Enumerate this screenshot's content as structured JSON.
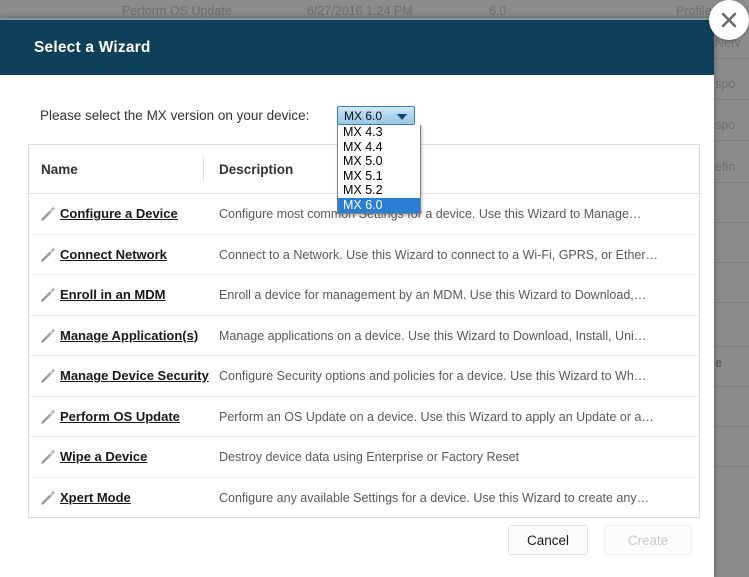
{
  "background": {
    "top_row": {
      "name": "Perform OS Update",
      "date": "6/27/2016 1:24 PM",
      "version": "6.0",
      "profile": "Profile"
    },
    "right_edge_fragments": [
      "Netv",
      "spo",
      "spo",
      "efin",
      "e"
    ]
  },
  "modal": {
    "title": "Select a Wizard",
    "close_label": "×",
    "prompt": "Please select the MX version on your device:",
    "help_icon_label": "?",
    "mx_select": {
      "value": "MX 6.0",
      "options": [
        "MX 4.3",
        "MX 4.4",
        "MX 5.0",
        "MX 5.1",
        "MX 5.2",
        "MX 6.0"
      ],
      "selected_index": 5,
      "expanded": true
    },
    "table": {
      "columns": [
        "Name",
        "Description"
      ],
      "rows": [
        {
          "icon": "wand-icon",
          "name": "Configure a Device",
          "description": "Configure most common Settings for a device. Use this Wizard to Manage…"
        },
        {
          "icon": "wand-icon",
          "name": "Connect Network",
          "description": "Connect to a Network. Use this Wizard to connect to a Wi-Fi, GPRS, or Ether…"
        },
        {
          "icon": "wand-icon",
          "name": "Enroll in an MDM",
          "description": "Enroll a device for management by an MDM.  Use this Wizard to Download,…"
        },
        {
          "icon": "wand-icon",
          "name": "Manage Application(s)",
          "description": "Manage applications on a device.  Use this Wizard to Download, Install, Uni…"
        },
        {
          "icon": "wand-icon",
          "name": "Manage Device Security",
          "description": "Configure Security options and policies for a device.  Use this Wizard to Wh…"
        },
        {
          "icon": "wand-icon",
          "name": "Perform OS Update",
          "description": "Perform an OS Update on a device.  Use this Wizard to apply an Update or a…"
        },
        {
          "icon": "wand-icon",
          "name": "Wipe a Device",
          "description": "Destroy device data using Enterprise or Factory Reset"
        },
        {
          "icon": "wand-icon",
          "name": "Xpert Mode",
          "description": "Configure any available Settings for a device. Use this Wizard to create any…"
        }
      ]
    },
    "footer": {
      "cancel_label": "Cancel",
      "create_label": "Create",
      "create_disabled": true
    }
  },
  "colors": {
    "header_bg": "#0e4159",
    "backdrop": "#8c8c8c",
    "select_border": "#3c7cb8",
    "option_highlight": "#2a7fd4",
    "body_bg": "#ffffff"
  }
}
